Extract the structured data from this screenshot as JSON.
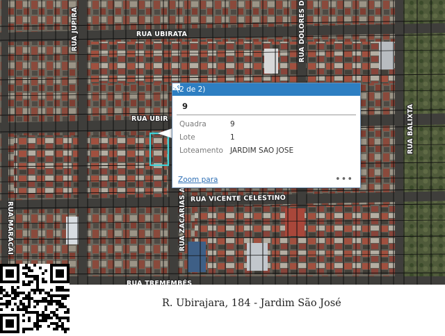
{
  "map": {
    "streets": [
      {
        "id": "rua-jupira",
        "label": "RUA JUPIRA"
      },
      {
        "id": "rua-ubirata",
        "label": "RUA UBIRATA"
      },
      {
        "id": "rua-dolores-duran",
        "label": "RUA DOLORES DU"
      },
      {
        "id": "rua-ubirajara",
        "label": "RUA UBIR"
      },
      {
        "id": "rua-balixta",
        "label": "RUA BALIXTA"
      },
      {
        "id": "rua-vicente-celestino",
        "label": "RUA VICENTE CELESTINO"
      },
      {
        "id": "rua-zacarias",
        "label": "RUA ZACARIAS AR"
      },
      {
        "id": "rua-maracai",
        "label": "RUA MARACAI"
      },
      {
        "id": "rua-tremembes",
        "label": "RUA TREMEMBÉS"
      }
    ],
    "parcel_outline_color": "#3fd2d8",
    "lot_line_color": "#111111"
  },
  "popup": {
    "count": "(2 de 2)",
    "title": "9",
    "attributes": [
      {
        "key": "Quadra",
        "value": "9"
      },
      {
        "key": "Lote",
        "value": "1"
      },
      {
        "key": "Loteamento",
        "value": "JARDIM SAO JOSE"
      }
    ],
    "zoom_link": "Zoom para",
    "more": "•••",
    "prev_icon": "triangle-left-icon",
    "maximize_icon": "maximize-icon",
    "close_icon": "close-icon",
    "header_color": "#2e7fc2"
  },
  "footer": {
    "address": "R. Ubirajara, 184 - Jardim São José"
  }
}
